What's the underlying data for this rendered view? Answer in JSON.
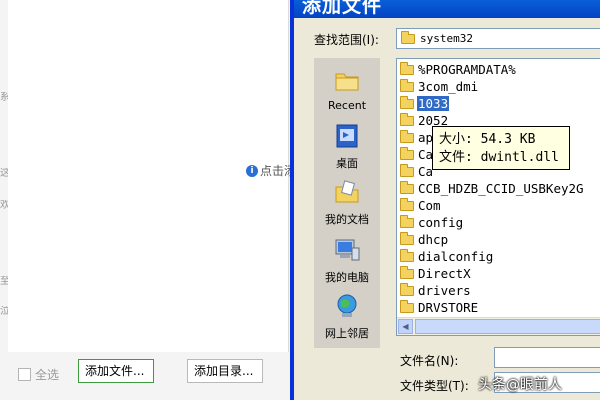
{
  "background_app": {
    "edge_glyphs": [
      "系",
      "这",
      "欢",
      "至",
      "泣"
    ],
    "info_hint": "点击添",
    "select_all_label": "全选",
    "add_file_button": "添加文件...",
    "add_directory_button": "添加目录..."
  },
  "dialog": {
    "title": "添加文件",
    "look_in_label": "查找范围(I):",
    "look_in_value": "system32",
    "places": [
      {
        "label": "Recent",
        "icon": "recent-folder-icon"
      },
      {
        "label": "桌面",
        "icon": "desktop-icon"
      },
      {
        "label": "我的文档",
        "icon": "my-documents-icon"
      },
      {
        "label": "我的电脑",
        "icon": "my-computer-icon"
      },
      {
        "label": "网上邻居",
        "icon": "network-places-icon"
      }
    ],
    "files": [
      "%PROGRAMDATA%",
      "3com_dmi",
      "1033",
      "2052",
      "ap",
      "Ca",
      "Ca",
      "CCB_HDZB_CCID_USBKey2G",
      "Com",
      "config",
      "dhcp",
      "dialconfig",
      "DirectX",
      "drivers",
      "DRVSTORE"
    ],
    "selected_file": "1033",
    "tooltip": {
      "size_line": "大小: 54.3 KB",
      "file_line": "文件: dwintl.dll"
    },
    "file_name_label": "文件名(N):",
    "file_type_label": "文件类型(T):",
    "file_name_value": "",
    "file_type_value": ""
  },
  "watermark": "头条@眼前人",
  "colors": {
    "titlebar": "#0a5fd8",
    "selection": "#316ac5",
    "tooltip_bg": "#ffffe1",
    "dialog_bg": "#ece9d8",
    "folder": "#f3d25f"
  }
}
